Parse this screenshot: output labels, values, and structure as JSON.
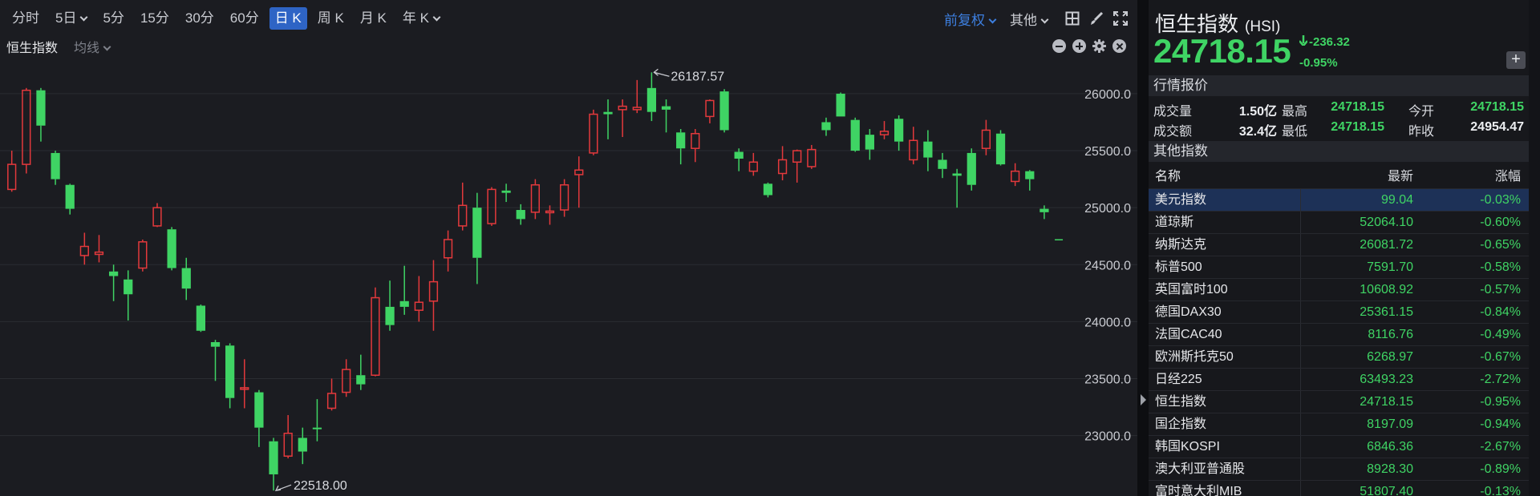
{
  "toolbar": {
    "timeframes": [
      {
        "label": "分时",
        "caret": false,
        "active": false
      },
      {
        "label": "5日",
        "caret": true,
        "active": false
      },
      {
        "label": "5分",
        "caret": false,
        "active": false
      },
      {
        "label": "15分",
        "caret": false,
        "active": false
      },
      {
        "label": "30分",
        "caret": false,
        "active": false
      },
      {
        "label": "60分",
        "caret": false,
        "active": false
      },
      {
        "label": "日 K",
        "caret": false,
        "active": true
      },
      {
        "label": "周 K",
        "caret": false,
        "active": false
      },
      {
        "label": "月 K",
        "caret": false,
        "active": false
      },
      {
        "label": "年 K",
        "caret": true,
        "active": false
      }
    ],
    "adjust_label": "前复权",
    "other_label": "其他",
    "tool_icons": [
      "layout-grid-icon",
      "brush-icon",
      "fullscreen-icon"
    ]
  },
  "subbar": {
    "indicator_name": "恒生指数",
    "ma_label": "均线",
    "tool_icons": [
      "zoom-out-icon",
      "zoom-in-icon",
      "settings-icon",
      "close-icon"
    ]
  },
  "chart_data": {
    "type": "candlestick",
    "y_ticks": [
      "26000.0",
      "25500.0",
      "25000.0",
      "24500.0",
      "24000.0",
      "23500.0",
      "23000.0"
    ],
    "ylim": [
      22470,
      26330
    ],
    "high_marker": {
      "label": "26187.57",
      "value": 26187.57
    },
    "low_marker": {
      "label": "22518.00",
      "value": 22518.0
    },
    "up_color": "#e3393c",
    "down_color": "#3fd464",
    "last_price": 24718.15,
    "candles": [
      {
        "o": 25160,
        "h": 25500,
        "c": 25380,
        "l": 25140
      },
      {
        "o": 25380,
        "h": 26050,
        "c": 26030,
        "l": 25300
      },
      {
        "o": 26030,
        "h": 26050,
        "c": 25720,
        "l": 25580
      },
      {
        "o": 25480,
        "h": 25500,
        "c": 25250,
        "l": 25200
      },
      {
        "o": 25200,
        "h": 25210,
        "c": 24990,
        "l": 24940
      },
      {
        "o": 24580,
        "h": 24780,
        "c": 24660,
        "l": 24500
      },
      {
        "o": 24590,
        "h": 24760,
        "c": 24610,
        "l": 24520
      },
      {
        "o": 24440,
        "h": 24500,
        "c": 24400,
        "l": 24180
      },
      {
        "o": 24370,
        "h": 24450,
        "c": 24240,
        "l": 24010
      },
      {
        "o": 24470,
        "h": 24720,
        "c": 24700,
        "l": 24440
      },
      {
        "o": 24840,
        "h": 25040,
        "c": 25000,
        "l": 24830
      },
      {
        "o": 24810,
        "h": 24830,
        "c": 24470,
        "l": 24450
      },
      {
        "o": 24470,
        "h": 24560,
        "c": 24290,
        "l": 24190
      },
      {
        "o": 24140,
        "h": 24150,
        "c": 23920,
        "l": 23910
      },
      {
        "o": 23820,
        "h": 23840,
        "c": 23780,
        "l": 23480
      },
      {
        "o": 23790,
        "h": 23810,
        "c": 23330,
        "l": 23240
      },
      {
        "o": 23420,
        "h": 23670,
        "c": 23420,
        "l": 23240
      },
      {
        "o": 23380,
        "h": 23400,
        "c": 23070,
        "l": 22900
      },
      {
        "o": 22950,
        "h": 22980,
        "c": 22660,
        "l": 22518
      },
      {
        "o": 22820,
        "h": 23180,
        "c": 23020,
        "l": 22800
      },
      {
        "o": 22980,
        "h": 23070,
        "c": 22860,
        "l": 22750
      },
      {
        "o": 23070,
        "h": 23320,
        "c": 23060,
        "l": 22950
      },
      {
        "o": 23240,
        "h": 23500,
        "c": 23370,
        "l": 23220
      },
      {
        "o": 23380,
        "h": 23670,
        "c": 23580,
        "l": 23340
      },
      {
        "o": 23530,
        "h": 23710,
        "c": 23450,
        "l": 23400
      },
      {
        "o": 23530,
        "h": 24300,
        "c": 24210,
        "l": 23520
      },
      {
        "o": 24130,
        "h": 24360,
        "c": 23970,
        "l": 23920
      },
      {
        "o": 24180,
        "h": 24490,
        "c": 24130,
        "l": 24060
      },
      {
        "o": 24100,
        "h": 24400,
        "c": 24170,
        "l": 24000
      },
      {
        "o": 24180,
        "h": 24540,
        "c": 24350,
        "l": 23920
      },
      {
        "o": 24560,
        "h": 24800,
        "c": 24720,
        "l": 24440
      },
      {
        "o": 24840,
        "h": 25220,
        "c": 25020,
        "l": 24800
      },
      {
        "o": 25000,
        "h": 25130,
        "c": 24560,
        "l": 24330
      },
      {
        "o": 24860,
        "h": 25180,
        "c": 25160,
        "l": 24840
      },
      {
        "o": 25150,
        "h": 25210,
        "c": 25130,
        "l": 25050
      },
      {
        "o": 24980,
        "h": 25030,
        "c": 24900,
        "l": 24850
      },
      {
        "o": 24960,
        "h": 25250,
        "c": 25200,
        "l": 24900
      },
      {
        "o": 24960,
        "h": 25020,
        "c": 24970,
        "l": 24850
      },
      {
        "o": 24980,
        "h": 25250,
        "c": 25200,
        "l": 24920
      },
      {
        "o": 25290,
        "h": 25450,
        "c": 25330,
        "l": 25000
      },
      {
        "o": 25480,
        "h": 25860,
        "c": 25820,
        "l": 25460
      },
      {
        "o": 25840,
        "h": 25950,
        "c": 25820,
        "l": 25600
      },
      {
        "o": 25860,
        "h": 25950,
        "c": 25890,
        "l": 25620
      },
      {
        "o": 25860,
        "h": 26120,
        "c": 25880,
        "l": 25830
      },
      {
        "o": 26050,
        "h": 26187,
        "c": 25840,
        "l": 25760
      },
      {
        "o": 25890,
        "h": 25950,
        "c": 25860,
        "l": 25660
      },
      {
        "o": 25660,
        "h": 25690,
        "c": 25520,
        "l": 25380
      },
      {
        "o": 25520,
        "h": 25690,
        "c": 25650,
        "l": 25400
      },
      {
        "o": 25800,
        "h": 25950,
        "c": 25940,
        "l": 25740
      },
      {
        "o": 26020,
        "h": 26040,
        "c": 25680,
        "l": 25660
      },
      {
        "o": 25490,
        "h": 25520,
        "c": 25430,
        "l": 25320
      },
      {
        "o": 25320,
        "h": 25480,
        "c": 25400,
        "l": 25280
      },
      {
        "o": 25210,
        "h": 25220,
        "c": 25110,
        "l": 25090
      },
      {
        "o": 25300,
        "h": 25540,
        "c": 25420,
        "l": 25240
      },
      {
        "o": 25400,
        "h": 25510,
        "c": 25500,
        "l": 25220
      },
      {
        "o": 25360,
        "h": 25550,
        "c": 25510,
        "l": 25340
      },
      {
        "o": 25750,
        "h": 25790,
        "c": 25680,
        "l": 25630
      },
      {
        "o": 26000,
        "h": 26010,
        "c": 25800,
        "l": 25800
      },
      {
        "o": 25770,
        "h": 25790,
        "c": 25500,
        "l": 25490
      },
      {
        "o": 25640,
        "h": 25690,
        "c": 25510,
        "l": 25420
      },
      {
        "o": 25640,
        "h": 25760,
        "c": 25670,
        "l": 25600
      },
      {
        "o": 25780,
        "h": 25810,
        "c": 25580,
        "l": 25500
      },
      {
        "o": 25420,
        "h": 25710,
        "c": 25590,
        "l": 25380
      },
      {
        "o": 25580,
        "h": 25680,
        "c": 25440,
        "l": 25320
      },
      {
        "o": 25420,
        "h": 25480,
        "c": 25340,
        "l": 25260
      },
      {
        "o": 25300,
        "h": 25340,
        "c": 25280,
        "l": 25000
      },
      {
        "o": 25480,
        "h": 25520,
        "c": 25200,
        "l": 25150
      },
      {
        "o": 25520,
        "h": 25770,
        "c": 25680,
        "l": 25460
      },
      {
        "o": 25650,
        "h": 25680,
        "c": 25380,
        "l": 25370
      },
      {
        "o": 25230,
        "h": 25390,
        "c": 25320,
        "l": 25190
      },
      {
        "o": 25320,
        "h": 25330,
        "c": 25250,
        "l": 25150
      },
      {
        "o": 24990,
        "h": 25020,
        "c": 24960,
        "l": 24900
      }
    ]
  },
  "quote": {
    "name": "恒生指数",
    "code": "(HSI)",
    "price": "24718.15",
    "change": "-236.32",
    "change_pct": "-0.95%",
    "add_label": "+",
    "section_title": "行情报价",
    "stats": [
      {
        "l1": "成交量",
        "v1": "1.50亿",
        "l2": "最高",
        "v2": "24718.15",
        "l3": "今开",
        "v3": "24718.15"
      },
      {
        "l1": "成交额",
        "v1": "32.4亿",
        "l2": "最低",
        "v2": "24718.15",
        "l3": "昨收",
        "v3": "24954.47"
      }
    ]
  },
  "other_indices": {
    "section_title": "其他指数",
    "headers": {
      "name": "名称",
      "latest": "最新",
      "change": "涨幅"
    },
    "rows": [
      {
        "name": "美元指数",
        "latest": "99.04",
        "change": "-0.03%",
        "selected": true
      },
      {
        "name": "道琼斯",
        "latest": "52064.10",
        "change": "-0.60%"
      },
      {
        "name": "纳斯达克",
        "latest": "26081.72",
        "change": "-0.65%"
      },
      {
        "name": "标普500",
        "latest": "7591.70",
        "change": "-0.58%"
      },
      {
        "name": "英国富时100",
        "latest": "10608.92",
        "change": "-0.57%"
      },
      {
        "name": "德国DAX30",
        "latest": "25361.15",
        "change": "-0.84%"
      },
      {
        "name": "法国CAC40",
        "latest": "8116.76",
        "change": "-0.49%"
      },
      {
        "name": "欧洲斯托克50",
        "latest": "6268.97",
        "change": "-0.67%"
      },
      {
        "name": "日经225",
        "latest": "63493.23",
        "change": "-2.72%"
      },
      {
        "name": "恒生指数",
        "latest": "24718.15",
        "change": "-0.95%"
      },
      {
        "name": "国企指数",
        "latest": "8197.09",
        "change": "-0.94%"
      },
      {
        "name": "韩国KOSPI",
        "latest": "6846.36",
        "change": "-2.67%"
      },
      {
        "name": "澳大利亚普通股",
        "latest": "8928.30",
        "change": "-0.89%"
      },
      {
        "name": "富时意大利MIB",
        "latest": "51807.40",
        "change": "-0.13%"
      }
    ]
  }
}
